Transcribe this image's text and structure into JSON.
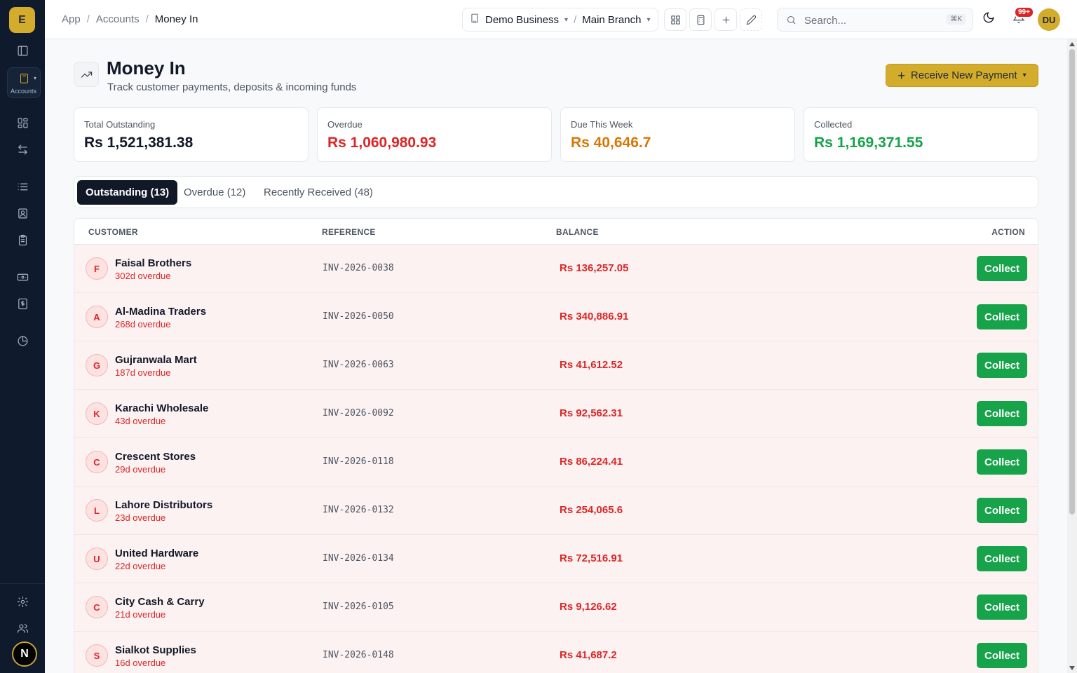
{
  "sidebar": {
    "logo_letter": "E",
    "module_label": "Accounts",
    "user_initial": "N"
  },
  "header": {
    "breadcrumbs": [
      "App",
      "Accounts",
      "Money In"
    ],
    "business": "Demo Business",
    "branch": "Main Branch",
    "search_placeholder": "Search...",
    "search_shortcut": "⌘K",
    "notification_count": "99+",
    "user_initials": "DU"
  },
  "page": {
    "title": "Money In",
    "subtitle": "Track customer payments, deposits & incoming funds",
    "primary_action": "Receive New Payment"
  },
  "stats": [
    {
      "label": "Total Outstanding",
      "value": "Rs 1,521,381.38",
      "color": "#111827"
    },
    {
      "label": "Overdue",
      "value": "Rs 1,060,980.93",
      "color": "#dc2626"
    },
    {
      "label": "Due This Week",
      "value": "Rs 40,646.7",
      "color": "#d97706"
    },
    {
      "label": "Collected",
      "value": "Rs 1,169,371.55",
      "color": "#16a34a"
    }
  ],
  "tabs": [
    {
      "label": "Outstanding (13)",
      "active": true
    },
    {
      "label": "Overdue (12)",
      "active": false
    },
    {
      "label": "Recently Received (48)",
      "active": false
    }
  ],
  "table": {
    "headers": {
      "customer": "CUSTOMER",
      "reference": "REFERENCE",
      "balance": "BALANCE",
      "action": "ACTION"
    },
    "action_label": "Collect",
    "rows": [
      {
        "initial": "F",
        "customer": "Faisal Brothers",
        "overdue": "302d overdue",
        "reference": "INV-2026-0038",
        "balance": "Rs 136,257.05"
      },
      {
        "initial": "A",
        "customer": "Al-Madina Traders",
        "overdue": "268d overdue",
        "reference": "INV-2026-0050",
        "balance": "Rs 340,886.91"
      },
      {
        "initial": "G",
        "customer": "Gujranwala Mart",
        "overdue": "187d overdue",
        "reference": "INV-2026-0063",
        "balance": "Rs 41,612.52"
      },
      {
        "initial": "K",
        "customer": "Karachi Wholesale",
        "overdue": "43d overdue",
        "reference": "INV-2026-0092",
        "balance": "Rs 92,562.31"
      },
      {
        "initial": "C",
        "customer": "Crescent Stores",
        "overdue": "29d overdue",
        "reference": "INV-2026-0118",
        "balance": "Rs 86,224.41"
      },
      {
        "initial": "L",
        "customer": "Lahore Distributors",
        "overdue": "23d overdue",
        "reference": "INV-2026-0132",
        "balance": "Rs 254,065.6"
      },
      {
        "initial": "U",
        "customer": "United Hardware",
        "overdue": "22d overdue",
        "reference": "INV-2026-0134",
        "balance": "Rs 72,516.91"
      },
      {
        "initial": "C",
        "customer": "City Cash & Carry",
        "overdue": "21d overdue",
        "reference": "INV-2026-0105",
        "balance": "Rs 9,126.62"
      },
      {
        "initial": "S",
        "customer": "Sialkot Supplies",
        "overdue": "16d overdue",
        "reference": "INV-2026-0148",
        "balance": "Rs 41,687.2"
      }
    ]
  }
}
